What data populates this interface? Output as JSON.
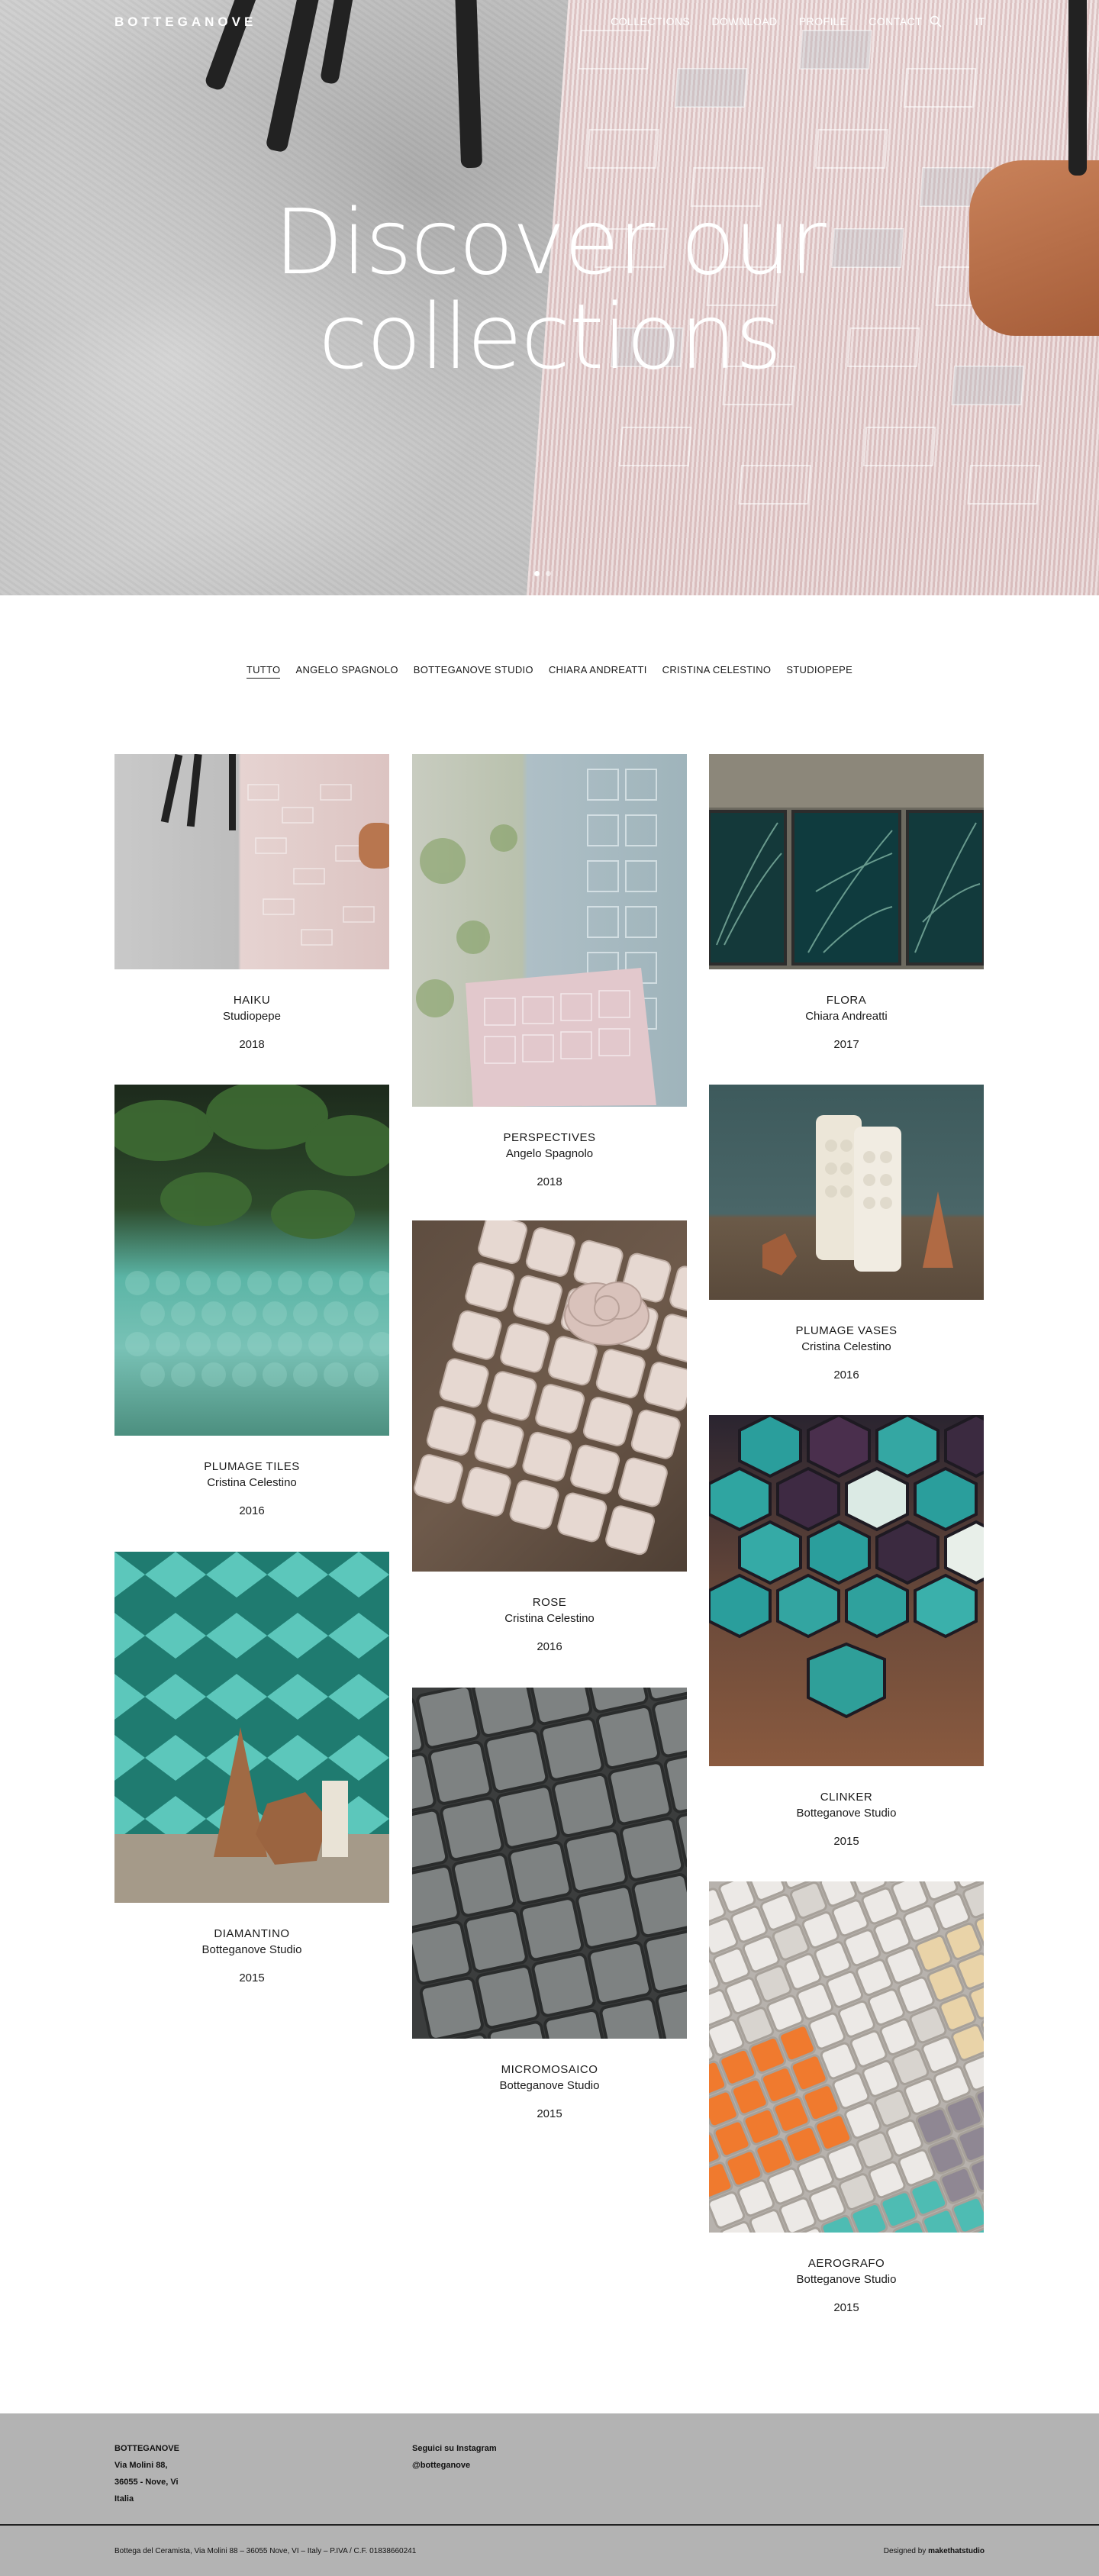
{
  "header": {
    "logo": "BOTTEGANOVE",
    "nav": [
      "COLLECTIONS",
      "DOWNLOAD",
      "PROFILE",
      "CONTACT"
    ],
    "lang": "IT",
    "search_icon": "search-icon"
  },
  "hero": {
    "title_line1": "Discover our",
    "title_line2": "collections"
  },
  "filters": [
    "TUTTO",
    "ANGELO SPAGNOLO",
    "BOTTEGANOVE STUDIO",
    "CHIARA ANDREATTI",
    "CRISTINA CELESTINO",
    "STUDIOPEPE"
  ],
  "collections": [
    {
      "name": "HAIKU",
      "author": "Studiopepe",
      "year": "2018"
    },
    {
      "name": "PERSPECTIVES",
      "author": "Angelo Spagnolo",
      "year": "2018"
    },
    {
      "name": "FLORA",
      "author": "Chiara Andreatti",
      "year": "2017"
    },
    {
      "name": "PLUMAGE TILES",
      "author": "Cristina Celestino",
      "year": "2016"
    },
    {
      "name": "ROSE",
      "author": "Cristina Celestino",
      "year": "2016"
    },
    {
      "name": "PLUMAGE VASES",
      "author": "Cristina Celestino",
      "year": "2016"
    },
    {
      "name": "DIAMANTINO",
      "author": "Botteganove Studio",
      "year": "2015"
    },
    {
      "name": "MICROMOSAICO",
      "author": "Botteganove Studio",
      "year": "2015"
    },
    {
      "name": "CLINKER",
      "author": "Botteganove Studio",
      "year": "2015"
    },
    {
      "name": "AEROGRAFO",
      "author": "Botteganove Studio",
      "year": "2015"
    }
  ],
  "footer": {
    "company": "BOTTEGANOVE",
    "address1": "Via Molini 88,",
    "address2": "36055 - Nove, Vi",
    "country": "Italia",
    "follow": "Seguici su Instagram",
    "instagram": "@botteganove",
    "legal": "Bottega del Ceramista, Via Molini 88 – 36055 Nove, VI – Italy – P.IVA / C.F. 01838660241",
    "designed_by": "Designed by",
    "designer": "makethatstudio"
  }
}
